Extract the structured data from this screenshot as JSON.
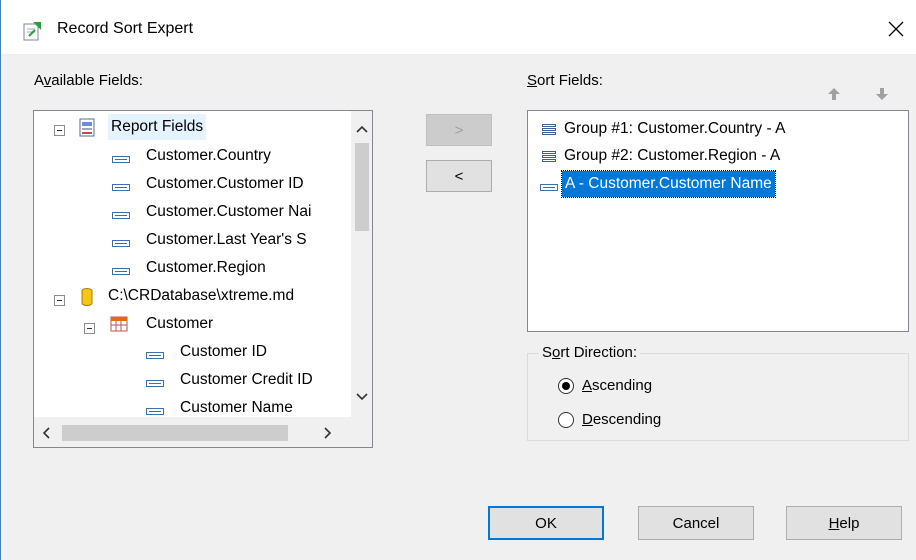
{
  "window": {
    "title": "Record Sort Expert",
    "close_glyph": "✕"
  },
  "available": {
    "label_prefix": "A",
    "label_underlined": "v",
    "label_rest": "ailable Fields:",
    "items": [
      {
        "label": "Report Fields",
        "icon": "report-fields-icon"
      },
      {
        "label": "Customer.Country",
        "icon": "field-icon"
      },
      {
        "label": "Customer.Customer ID",
        "icon": "field-icon"
      },
      {
        "label": "Customer.Customer Nai",
        "icon": "field-icon"
      },
      {
        "label": "Customer.Last Year's S",
        "icon": "field-icon"
      },
      {
        "label": "Customer.Region",
        "icon": "field-icon"
      },
      {
        "label": "C:\\CRDatabase\\xtreme.md",
        "icon": "database-icon"
      },
      {
        "label": "Customer",
        "icon": "table-icon"
      },
      {
        "label": "Customer ID",
        "icon": "field-icon"
      },
      {
        "label": "Customer Credit ID",
        "icon": "field-icon"
      },
      {
        "label": "Customer Name",
        "icon": "field-icon"
      }
    ],
    "scroll_up": "^",
    "scroll_down": "v",
    "scroll_left": "<",
    "scroll_right": ">"
  },
  "transfer": {
    "add_label": ">",
    "remove_label": "<"
  },
  "sort_fields": {
    "label_underlined": "S",
    "label_rest": "ort Fields:",
    "items": [
      {
        "label": "Group #1: Customer.Country - A",
        "icon": "group-icon"
      },
      {
        "label": "Group #2: Customer.Region - A",
        "icon": "group-icon"
      },
      {
        "label": "A - Customer.Customer Name",
        "icon": "field-icon",
        "selected": true
      }
    ],
    "move_up_icon": "up-arrow-icon",
    "move_down_icon": "down-arrow-icon"
  },
  "sort_direction": {
    "legend_pre": "S",
    "legend_underlined": "o",
    "legend_rest": "rt Direction:",
    "ascending_underlined": "A",
    "ascending_rest": "scending",
    "descending_underlined": "D",
    "descending_rest": "escending",
    "selected": "Ascending"
  },
  "buttons": {
    "ok": "OK",
    "cancel": "Cancel",
    "help_underlined": "H",
    "help_rest": "elp"
  },
  "colors": {
    "selection": "#0078d7",
    "accent_border": "#0078d7"
  }
}
